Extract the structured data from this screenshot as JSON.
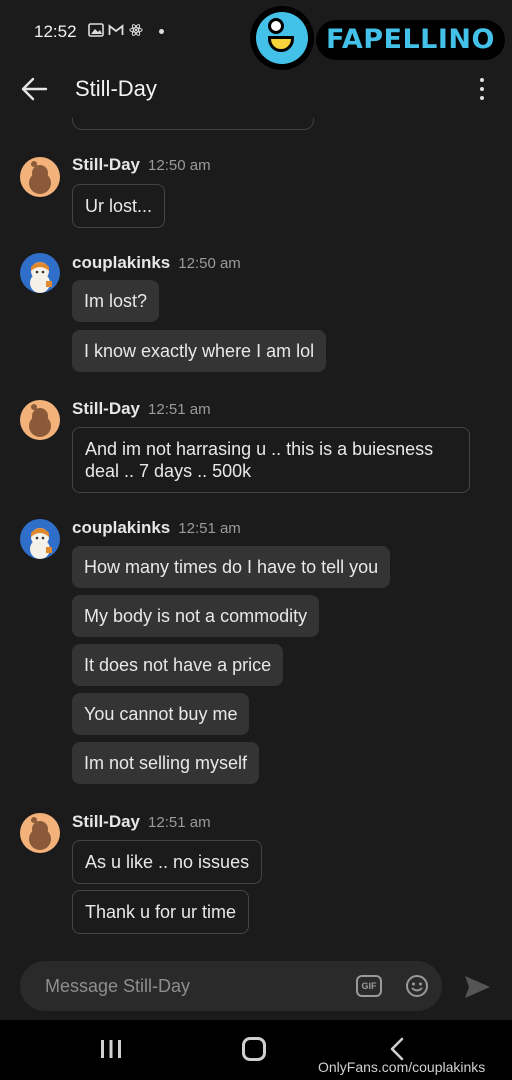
{
  "status_bar": {
    "time": "12:52"
  },
  "watermark_logo": {
    "text": "FAPELLINO"
  },
  "header": {
    "title": "Still-Day"
  },
  "messages": [
    {
      "sender": "Still-Day",
      "time": "12:50 am",
      "bubbles": [
        "Ur lost..."
      ]
    },
    {
      "sender": "couplakinks",
      "time": "12:50 am",
      "bubbles": [
        "Im lost?",
        "I know exactly where I am lol"
      ]
    },
    {
      "sender": "Still-Day",
      "time": "12:51 am",
      "bubbles": [
        "And im not harrasing u .. this is a buiesness deal .. 7 days .. 500k"
      ]
    },
    {
      "sender": "couplakinks",
      "time": "12:51 am",
      "bubbles": [
        "How many times do I have to tell you",
        "My body is not a commodity",
        "It does not have a price",
        "You cannot buy me",
        "Im not selling myself"
      ]
    },
    {
      "sender": "Still-Day",
      "time": "12:51 am",
      "bubbles": [
        "As u like .. no issues",
        "Thank u for ur time"
      ]
    }
  ],
  "composer": {
    "placeholder": "Message Still-Day",
    "gif_label": "GIF"
  },
  "footer_watermark": "OnlyFans.com/couplakinks"
}
